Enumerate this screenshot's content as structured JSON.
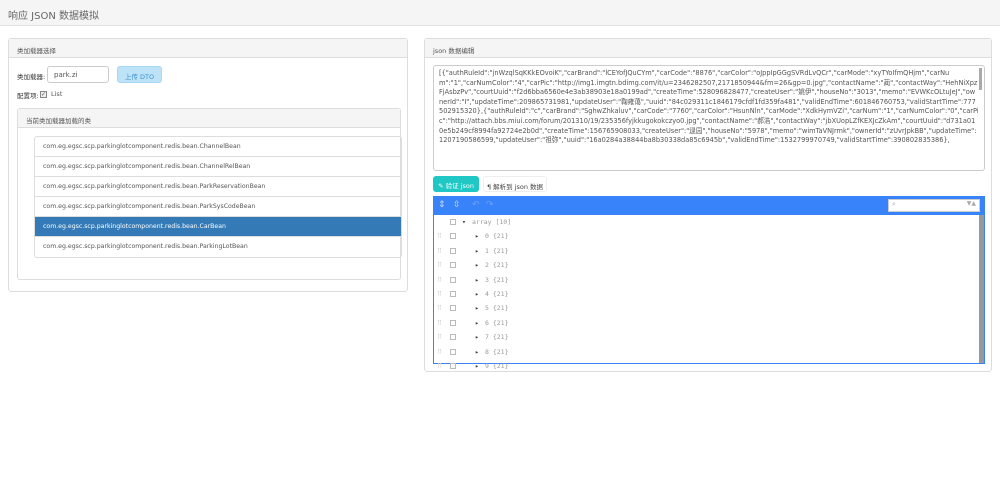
{
  "page": {
    "title": "响应 JSON 数据模拟"
  },
  "loader_panel": {
    "title": "类加载器选择",
    "loader_label": "类加载器:",
    "loader_value": "park.zi",
    "upload_button": "上传 DTO",
    "config_label": "配置项:",
    "list_checkbox_label": "List",
    "list_checked": true,
    "classes_title": "当前类加载器加载的类",
    "classes": [
      "com.eg.egsc.scp.parkinglotcomponent.redis.bean.ChannelBean",
      "com.eg.egsc.scp.parkinglotcomponent.redis.bean.ChannelRelBean",
      "com.eg.egsc.scp.parkinglotcomponent.redis.bean.ParkReservationBean",
      "com.eg.egsc.scp.parkinglotcomponent.redis.bean.ParkSysCodeBean",
      "com.eg.egsc.scp.parkinglotcomponent.redis.bean.CarBean",
      "com.eg.egsc.scp.parkinglotcomponent.redis.bean.ParkingLotBean"
    ],
    "selected_class_index": 4,
    "accent": "#337ab7"
  },
  "json_panel": {
    "title": "json 数据编辑",
    "json_text": "[{\"authRuleId\":\"jnWzqlSqKKkEOvoiK\",\"carBrand\":\"lCEYofJQuCYm\",\"carCode\":\"8876\",\"carColor\":\"oJppIpGGgSVRdLvQCr\",\"carMode\":\"xyTYoIfmQHjm\",\"carNum\":\"1\",\"carNumColor\":\"4\",\"carPic\":\"http://img1.imgtn.bdimg.com/it/u=2346282507,2171850944&fm=26&gp=0.jpg\",\"contactName\":\"蔺\",\"contactWay\":\"HehNiXpzFjAsbzPv\",\"courtUuid\":\"f2d6bba6560e4e3ab38903e18a0199ad\",\"createTime\":528096828477,\"createUser\":\"姚伊\",\"houseNo\":\"3013\",\"memo\":\"EVWKcOLtuJeJ\",\"ownerId\":\"I\",\"updateTime\":209865731981,\"updateUser\":\"鞠雍蔼\",\"uuid\":\"84c029311c1846179cfdf1fd359fa481\",\"validEndTime\":601846760753,\"validStartTime\":777502915320},{\"authRuleId\":\"c\",\"carBrand\":\"SghwZhkaluv\",\"carCode\":\"7760\",\"carColor\":\"HsunNln\",\"carMode\":\"XdkHymVZi\",\"carNum\":\"1\",\"carNumColor\":\"0\",\"carPic\":\"http://attach.bbs.miui.com/forum/201310/19/235356fyjkkugokokczyo0.jpg\",\"contactName\":\"郝浩\",\"contactWay\":\"jbXUopLZfKEXJcZkAm\",\"courtUuid\":\"d731a010e5b249cf8994fa92724e2b0d\",\"createTime\":156765908033,\"createUser\":\"逯园\",\"houseNo\":\"5978\",\"memo\":\"wimTaVNJrmk\",\"ownerId\":\"zUvrJpkBB\",\"updateTime\":1207190586599,\"updateUser\":\"祖弥\",\"uuid\":\"16a0284a38844ba8b30338da85c6945b\",\"validEndTime\":1532799970749,\"validStartTime\":390802835386},",
    "validate_button": "验证 json",
    "parse_button": "解析到 json 数据",
    "tree": {
      "root": "array [10]",
      "items": [
        "0 {21}",
        "1 {21}",
        "2 {21}",
        "3 {21}",
        "4 {21}",
        "5 {21}",
        "6 {21}",
        "7 {21}",
        "8 {21}",
        "9 {21}"
      ]
    },
    "accent": "#3883fa",
    "validate_color": "#1fc8c4"
  }
}
